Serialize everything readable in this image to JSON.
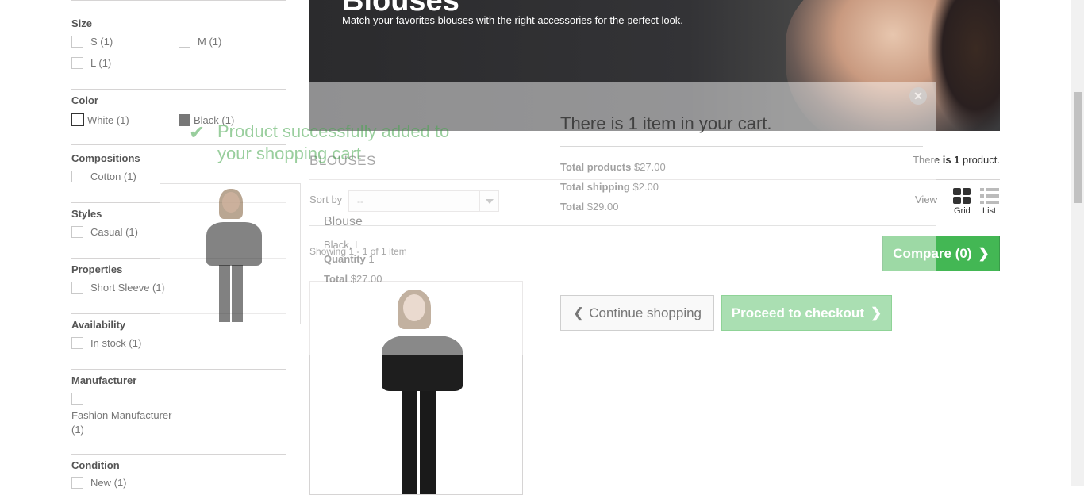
{
  "filters": {
    "size": {
      "title": "Size",
      "options": [
        "S (1)",
        "M (1)",
        "L (1)"
      ]
    },
    "color": {
      "title": "Color",
      "options": [
        "White (1)",
        "Black (1)"
      ],
      "swatches": [
        "#ffffff",
        "#777777"
      ]
    },
    "compositions": {
      "title": "Compositions",
      "options": [
        "Cotton (1)"
      ]
    },
    "styles": {
      "title": "Styles",
      "options": [
        "Casual (1)"
      ]
    },
    "properties": {
      "title": "Properties",
      "options": [
        "Short Sleeve (1)"
      ]
    },
    "availability": {
      "title": "Availability",
      "options": [
        "In stock (1)"
      ]
    },
    "manufacturer": {
      "title": "Manufacturer",
      "options": [
        "Fashion Manufacturer",
        "(1)"
      ]
    },
    "condition": {
      "title": "Condition",
      "options": [
        "New (1)"
      ]
    }
  },
  "banner": {
    "title": "Blouses",
    "subtitle": "Match your favorites blouses with the right accessories for the perfect look."
  },
  "category": {
    "title": "BLOUSES",
    "count_prefix": "There",
    "count_bold": "is 1",
    "count_suffix": "product.",
    "sort_label": "Sort by",
    "sort_value": "--",
    "view_label": "View",
    "grid_label": "Grid",
    "list_label": "List",
    "showing": "Showing 1 - 1 of 1 item",
    "compare_label": "Compare (0)"
  },
  "modal": {
    "success_line1": "Product successfully added to",
    "success_line2": "your shopping cart",
    "item_name": "Blouse",
    "item_attr": "Black, L",
    "quantity_label": "Quantity",
    "quantity_value": "1",
    "total_label": "Total",
    "total_value": "$27.00",
    "cart_heading": "There is 1 item in your cart.",
    "total_products_label": "Total products",
    "total_products_value": "$27.00",
    "total_shipping_label": "Total shipping",
    "total_shipping_value": "$2.00",
    "grand_total_label": "Total",
    "grand_total_value": "$29.00",
    "continue_label": "Continue shopping",
    "checkout_label": "Proceed to checkout",
    "close_icon": "close-icon"
  },
  "colors": {
    "accent_green": "#43b754",
    "text_dark": "#333333",
    "border": "#d6d4d4"
  }
}
